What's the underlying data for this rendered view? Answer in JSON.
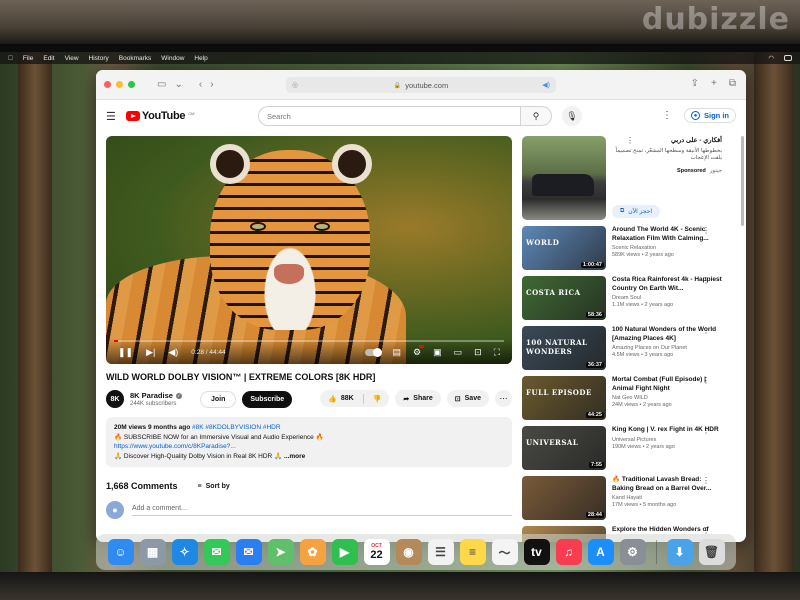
{
  "watermark": "dubizzle",
  "menubar": {
    "items": [
      "File",
      "Edit",
      "View",
      "History",
      "Bookmarks",
      "Window",
      "Help"
    ]
  },
  "browser": {
    "url": "youtube.com"
  },
  "youtube": {
    "logo_text": "YouTube",
    "logo_suffix": "CM",
    "search_placeholder": "Search",
    "signin_label": "Sign in",
    "video": {
      "title": "WILD WORLD DOLBY VISION™ | EXTREME COLORS [8K HDR]",
      "time": "0:28 / 44:44",
      "progress_fraction": 0.0104,
      "channel_avatar": "8K",
      "channel_name": "8K Paradise",
      "subscribers": "244K subscribers",
      "join_label": "Join",
      "subscribe_label": "Subscribe",
      "likes": "88K",
      "share_label": "Share",
      "save_label": "Save",
      "description": {
        "meta": "20M views  9 months ago",
        "tags": "#8K #8KDOLBYVISION #HDR",
        "line1": "🔥 SUBSCRIBE NOW for an Immersive Visual and Audio Experience 🔥",
        "link": "https://www.youtube.com/c/8KParadise?...",
        "line2": "🙏 Discover High-Quality Dolby Vision in Real 8K HDR 🙏",
        "more": "...more"
      }
    },
    "comments": {
      "count": "1,668 Comments",
      "sort_label": "Sort by",
      "add_placeholder": "Add a comment..."
    },
    "ad": {
      "title": "أفكاري - على دربي",
      "description": "بخطوطها الأنيقة وسطحها المشعّر، تمنح تصميماً يلفت الإعجاب",
      "sponsored": "Sponsored",
      "advertiser": "جيتور",
      "cta": "احجز الآن"
    },
    "recommendations": [
      {
        "title": "Around The World 4K - Scenic Relaxation Film With Calming...",
        "channel": "Scenic Relaxation",
        "meta": "589K views • 2 years ago",
        "duration": "1:00:47",
        "thumb_label": "WORLD",
        "thumb_color": "#5d88b8"
      },
      {
        "title": "Costa Rica Rainforest 4k - Happiest Country On Earth Wit...",
        "channel": "Dream Soul",
        "meta": "1.1M views • 2 years ago",
        "duration": "58:36",
        "thumb_label": "COSTA RICA",
        "thumb_color": "#3f6a34"
      },
      {
        "title": "100 Natural Wonders of the World [Amazing Places 4K]",
        "channel": "Amazing Places on Our Planet",
        "meta": "4.5M views • 3 years ago",
        "duration": "36:37",
        "thumb_label": "100 NATURAL WONDERS",
        "thumb_color": "#3a4a58"
      },
      {
        "title": "Mortal Combat (Full Episode) | Animal Fight Night",
        "channel": "Nat Geo WILD",
        "meta": "24M views • 2 years ago",
        "duration": "44:25",
        "thumb_label": "FULL EPISODE",
        "thumb_color": "#6a5a2e"
      },
      {
        "title": "King Kong | V. rex Fight in 4K HDR",
        "channel": "Universal Pictures",
        "meta": "190M views • 2 years ago",
        "duration": "7:55",
        "thumb_label": "UNIVERSAL",
        "thumb_color": "#4a4a44"
      },
      {
        "title": "🔥 Traditional Lavash Bread: Baking Bread on a Barrel Over...",
        "channel": "Kand Hayati",
        "meta": "17M views • 5 months ago",
        "duration": "28:44",
        "thumb_label": "",
        "thumb_color": "#7a5a3a"
      },
      {
        "title": "Explore the Hidden Wonders of",
        "channel": "",
        "meta": "",
        "duration": "",
        "thumb_label": "",
        "thumb_color": "#b08850"
      }
    ]
  },
  "dock": {
    "calendar_month": "OCT",
    "calendar_day": "22",
    "apps": [
      {
        "name": "finder-icon",
        "color": "#2f8bef",
        "glyph": "☺"
      },
      {
        "name": "launchpad-icon",
        "color": "#8c9aa8",
        "glyph": "▦"
      },
      {
        "name": "safari-icon",
        "color": "#1e88e5",
        "glyph": "✧"
      },
      {
        "name": "messages-icon",
        "color": "#34c759",
        "glyph": "✉"
      },
      {
        "name": "mail-icon",
        "color": "#2a7ff0",
        "glyph": "✉"
      },
      {
        "name": "maps-icon",
        "color": "#5fbf6a",
        "glyph": "➤"
      },
      {
        "name": "photos-icon",
        "color": "#f4a340",
        "glyph": "✿"
      },
      {
        "name": "facetime-icon",
        "color": "#2fbf4f",
        "glyph": "▶"
      },
      {
        "name": "calendar-icon",
        "color": "#ffffff",
        "glyph": ""
      },
      {
        "name": "contacts-icon",
        "color": "#b48a5a",
        "glyph": "◉"
      },
      {
        "name": "reminders-icon",
        "color": "#f2f2f2",
        "glyph": "☰"
      },
      {
        "name": "notes-icon",
        "color": "#ffd84a",
        "glyph": "≡"
      },
      {
        "name": "freeform-icon",
        "color": "#f4f4f4",
        "glyph": "〜"
      },
      {
        "name": "apple-tv-icon",
        "color": "#111111",
        "glyph": "tv"
      },
      {
        "name": "music-icon",
        "color": "#fa3c50",
        "glyph": "♫"
      },
      {
        "name": "app-store-icon",
        "color": "#1c8ef9",
        "glyph": "A"
      },
      {
        "name": "system-settings-icon",
        "color": "#8a8f96",
        "glyph": "⚙"
      },
      {
        "name": "downloads-folder-icon",
        "color": "#4aa3e8",
        "glyph": "⬇"
      },
      {
        "name": "trash-icon",
        "color": "#dcdcdc",
        "glyph": "🗑"
      }
    ]
  }
}
